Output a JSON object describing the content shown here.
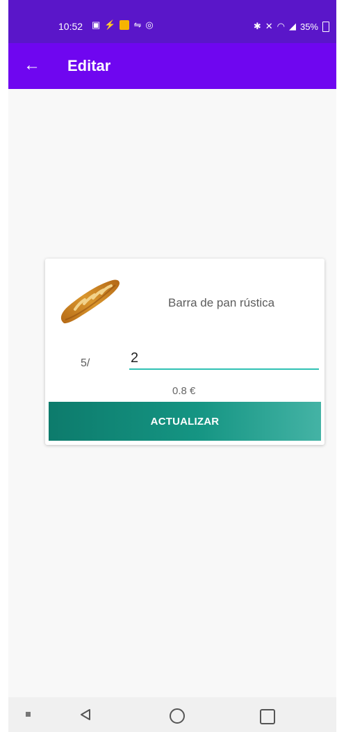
{
  "status_bar": {
    "time": "10:52",
    "battery": "35%"
  },
  "app_bar": {
    "title": "Editar"
  },
  "product": {
    "name": "Barra de pan rústica",
    "stock": "5/",
    "quantity": "2",
    "price": "0.8 €",
    "update_label": "ACTUALIZAR"
  },
  "colors": {
    "status_bar": "#5a16c9",
    "app_bar": "#6f06f0",
    "accent": "#2fc1b3"
  },
  "icons": {
    "back": "back-arrow-icon",
    "nav_back": "triangle-back-icon",
    "nav_home": "circle-home-icon",
    "nav_recents": "square-recents-icon"
  }
}
